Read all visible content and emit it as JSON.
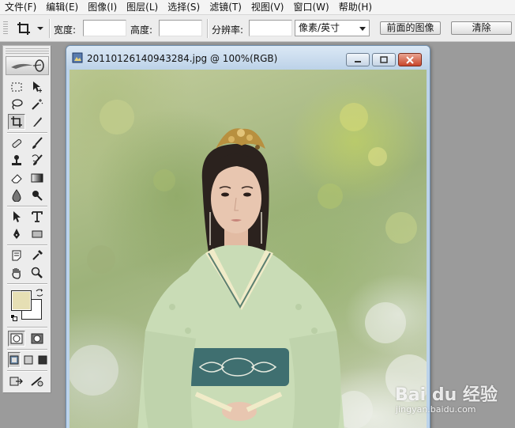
{
  "menu": {
    "items": [
      "文件(F)",
      "编辑(E)",
      "图像(I)",
      "图层(L)",
      "选择(S)",
      "滤镜(T)",
      "视图(V)",
      "窗口(W)",
      "帮助(H)"
    ]
  },
  "options_bar": {
    "active_tool": "crop-icon",
    "width_label": "宽度:",
    "width_value": "",
    "height_label": "高度:",
    "height_value": "",
    "resolution_label": "分辨率:",
    "resolution_value": "",
    "unit_selected": "像素/英寸",
    "front_image_button": "前面的图像",
    "clear_button": "清除"
  },
  "toolbox": {
    "foreground_color": "#e6dfb4",
    "background_color": "#ffffff",
    "tools": [
      "marquee-icon",
      "move-icon",
      "lasso-icon",
      "magic-wand-icon",
      "crop-icon",
      "slice-icon",
      "healing-brush-icon",
      "brush-icon",
      "clone-stamp-icon",
      "history-brush-icon",
      "eraser-icon",
      "gradient-icon",
      "blur-icon",
      "dodge-icon",
      "path-select-icon",
      "type-icon",
      "pen-icon",
      "shape-icon",
      "notes-icon",
      "eyedropper-icon",
      "hand-icon",
      "zoom-icon"
    ],
    "active_tool": "crop-icon"
  },
  "document": {
    "title": "20110126140943284.jpg @ 100%(RGB)",
    "colors": {
      "garment": "#c9dcb6",
      "sash": "#3f6f70",
      "hair": "#2b221e",
      "skin": "#e8c6b0",
      "ornament": "#b8903f"
    }
  },
  "watermark": {
    "brand": "Bai du 经验",
    "url": "jingyan.baidu.com"
  }
}
